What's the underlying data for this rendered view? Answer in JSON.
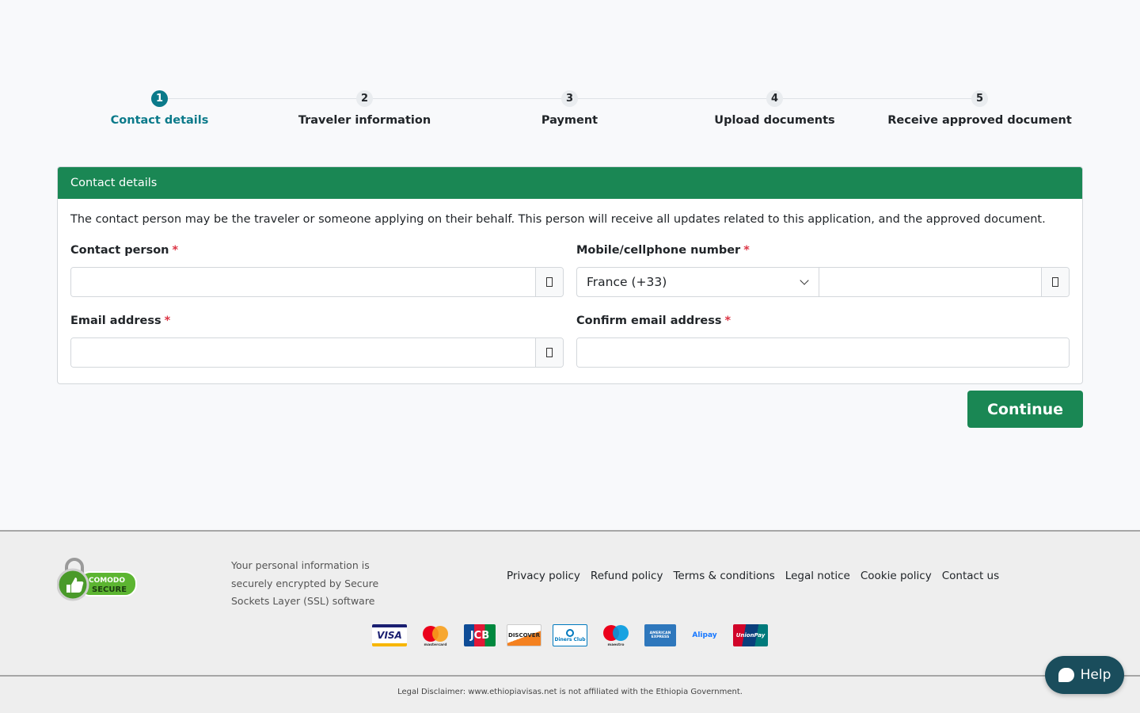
{
  "stepper": {
    "steps": [
      {
        "number": "1",
        "label": "Contact details",
        "active": true
      },
      {
        "number": "2",
        "label": "Traveler information",
        "active": false
      },
      {
        "number": "3",
        "label": "Payment",
        "active": false
      },
      {
        "number": "4",
        "label": "Upload documents",
        "active": false
      },
      {
        "number": "5",
        "label": "Receive approved document",
        "active": false
      }
    ]
  },
  "card": {
    "title": "Contact details",
    "intro": "The contact person may be the traveler or someone applying on their behalf. This person will receive all updates related to this application, and the approved document.",
    "fields": {
      "contact_person": {
        "label": "Contact person",
        "required": "*",
        "value": ""
      },
      "mobile": {
        "label": "Mobile/cellphone number",
        "required": "*",
        "country": "France (+33)",
        "value": ""
      },
      "email": {
        "label": "Email address",
        "required": "*",
        "value": ""
      },
      "confirm_email": {
        "label": "Confirm email address",
        "required": "*",
        "value": ""
      }
    }
  },
  "actions": {
    "continue_label": "Continue"
  },
  "footer": {
    "comodo": {
      "line1": "COMODO",
      "line2": "SECURE"
    },
    "ssl_text": "Your personal information is securely encrypted by Secure Sockets Layer (SSL) software",
    "links": [
      "Privacy policy",
      "Refund policy",
      "Terms & conditions",
      "Legal notice",
      "Cookie policy",
      "Contact us"
    ],
    "payment_cards": {
      "visa": "VISA",
      "mastercard": "mastercard",
      "jcb": "JCB",
      "discover": "DISCOVER",
      "diners": "Diners Club",
      "maestro": "maestro",
      "amex": "AMERICAN EXPRESS",
      "alipay": "Alipay",
      "unionpay": "UnionPay"
    },
    "legal": "Legal Disclaimer: www.ethiopiavisas.net is not affiliated with the Ethiopia Government."
  },
  "help": {
    "label": "Help"
  },
  "colors": {
    "primary_green": "#1a8754",
    "step_active": "#0b7a8a",
    "required": "#dc3545",
    "help_bg": "#1a4d5c"
  }
}
